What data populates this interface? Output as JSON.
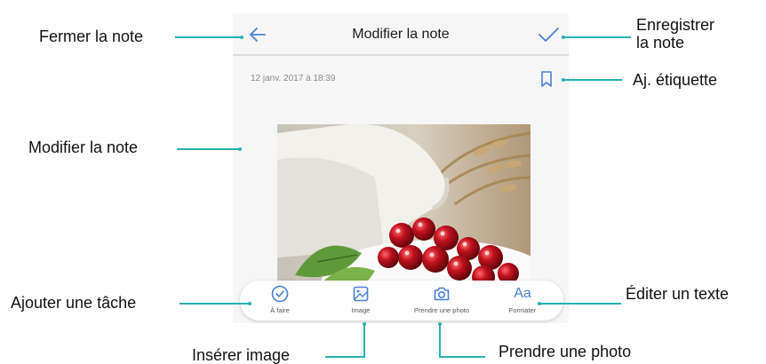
{
  "screen": {
    "title": "Modifier la note",
    "date": "12 janv. 2017 à 18:39",
    "toolbar": [
      {
        "label": "À faire",
        "icon": "check-circle-icon"
      },
      {
        "label": "Image",
        "icon": "image-icon"
      },
      {
        "label": "Prendre une photo",
        "icon": "camera-icon"
      },
      {
        "label": "Formater",
        "icon": "text-format-icon",
        "glyph": "Aa"
      }
    ]
  },
  "callouts": {
    "close": "Fermer la note",
    "save_line1": "Enregistrer",
    "save_line2": "la note",
    "tag": "Aj. étiquette",
    "edit": "Modifier la note",
    "task": "Ajouter une tâche",
    "format": "Éditer un texte",
    "insert_image": "Insérer image",
    "take_photo": "Prendre une photo"
  },
  "colors": {
    "accent": "#4a7fd8",
    "leader": "#27b1b5"
  }
}
